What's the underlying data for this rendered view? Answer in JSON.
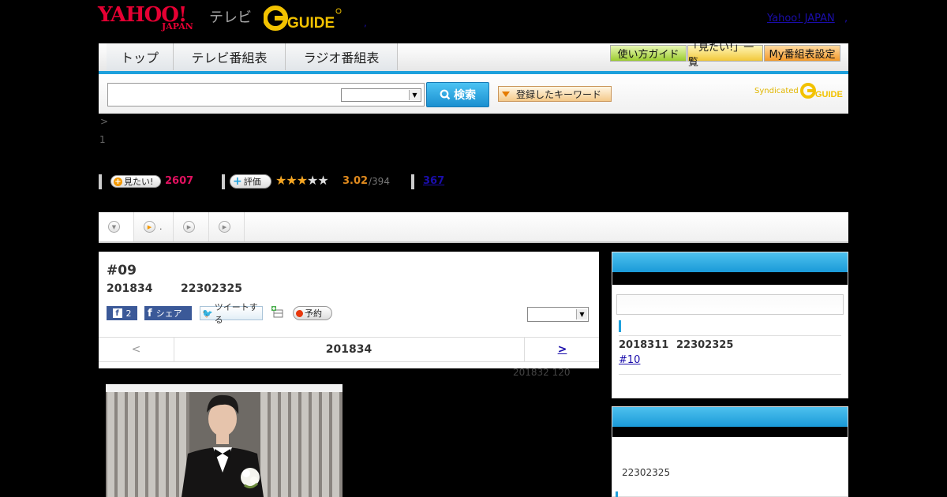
{
  "header": {
    "logo_main": "YAHOO!",
    "logo_sub": "JAPAN",
    "logo_tv": "テレビ",
    "logo_gguide": "GUIDE",
    "yahoo_japan_link": "Yahoo! JAPAN",
    "right_dot": ",",
    "left_dot": ","
  },
  "nav": {
    "tabs": [
      "トップ",
      "テレビ番組表",
      "ラジオ番組表"
    ],
    "buttons": [
      "使い方ガイド",
      "「見たい!」一覧",
      "My番組表設定"
    ],
    "accent_color": "#1ea0dc"
  },
  "search": {
    "button_label": "検索",
    "keyword_button": "登録したキーワード",
    "syndicated": "Syndicated",
    "syndicated_logo": "GUIDE"
  },
  "breadcrumb": {
    "line1": ">",
    "line2": "1"
  },
  "stats": {
    "want_label": "見たい!",
    "want_count": "2607",
    "rate_label": "評価",
    "stars": 3,
    "rating": "3.02",
    "rating_count": "/394",
    "third_count": "367"
  },
  "subtabs": {
    "second_label": "."
  },
  "program": {
    "title": "#09",
    "date": "201834",
    "time": "22302325",
    "like_count": "2",
    "share_label": "シェア",
    "tweet_label": "ツイートする",
    "reserve_label": "予約",
    "prev_label": "<",
    "current_day": "201834",
    "next_label": ">",
    "update_note": "201832  120"
  },
  "sidebar": {
    "next_date": "2018311",
    "next_time": "22302325",
    "next_episode": "#10",
    "panel2_time": "22302325"
  }
}
